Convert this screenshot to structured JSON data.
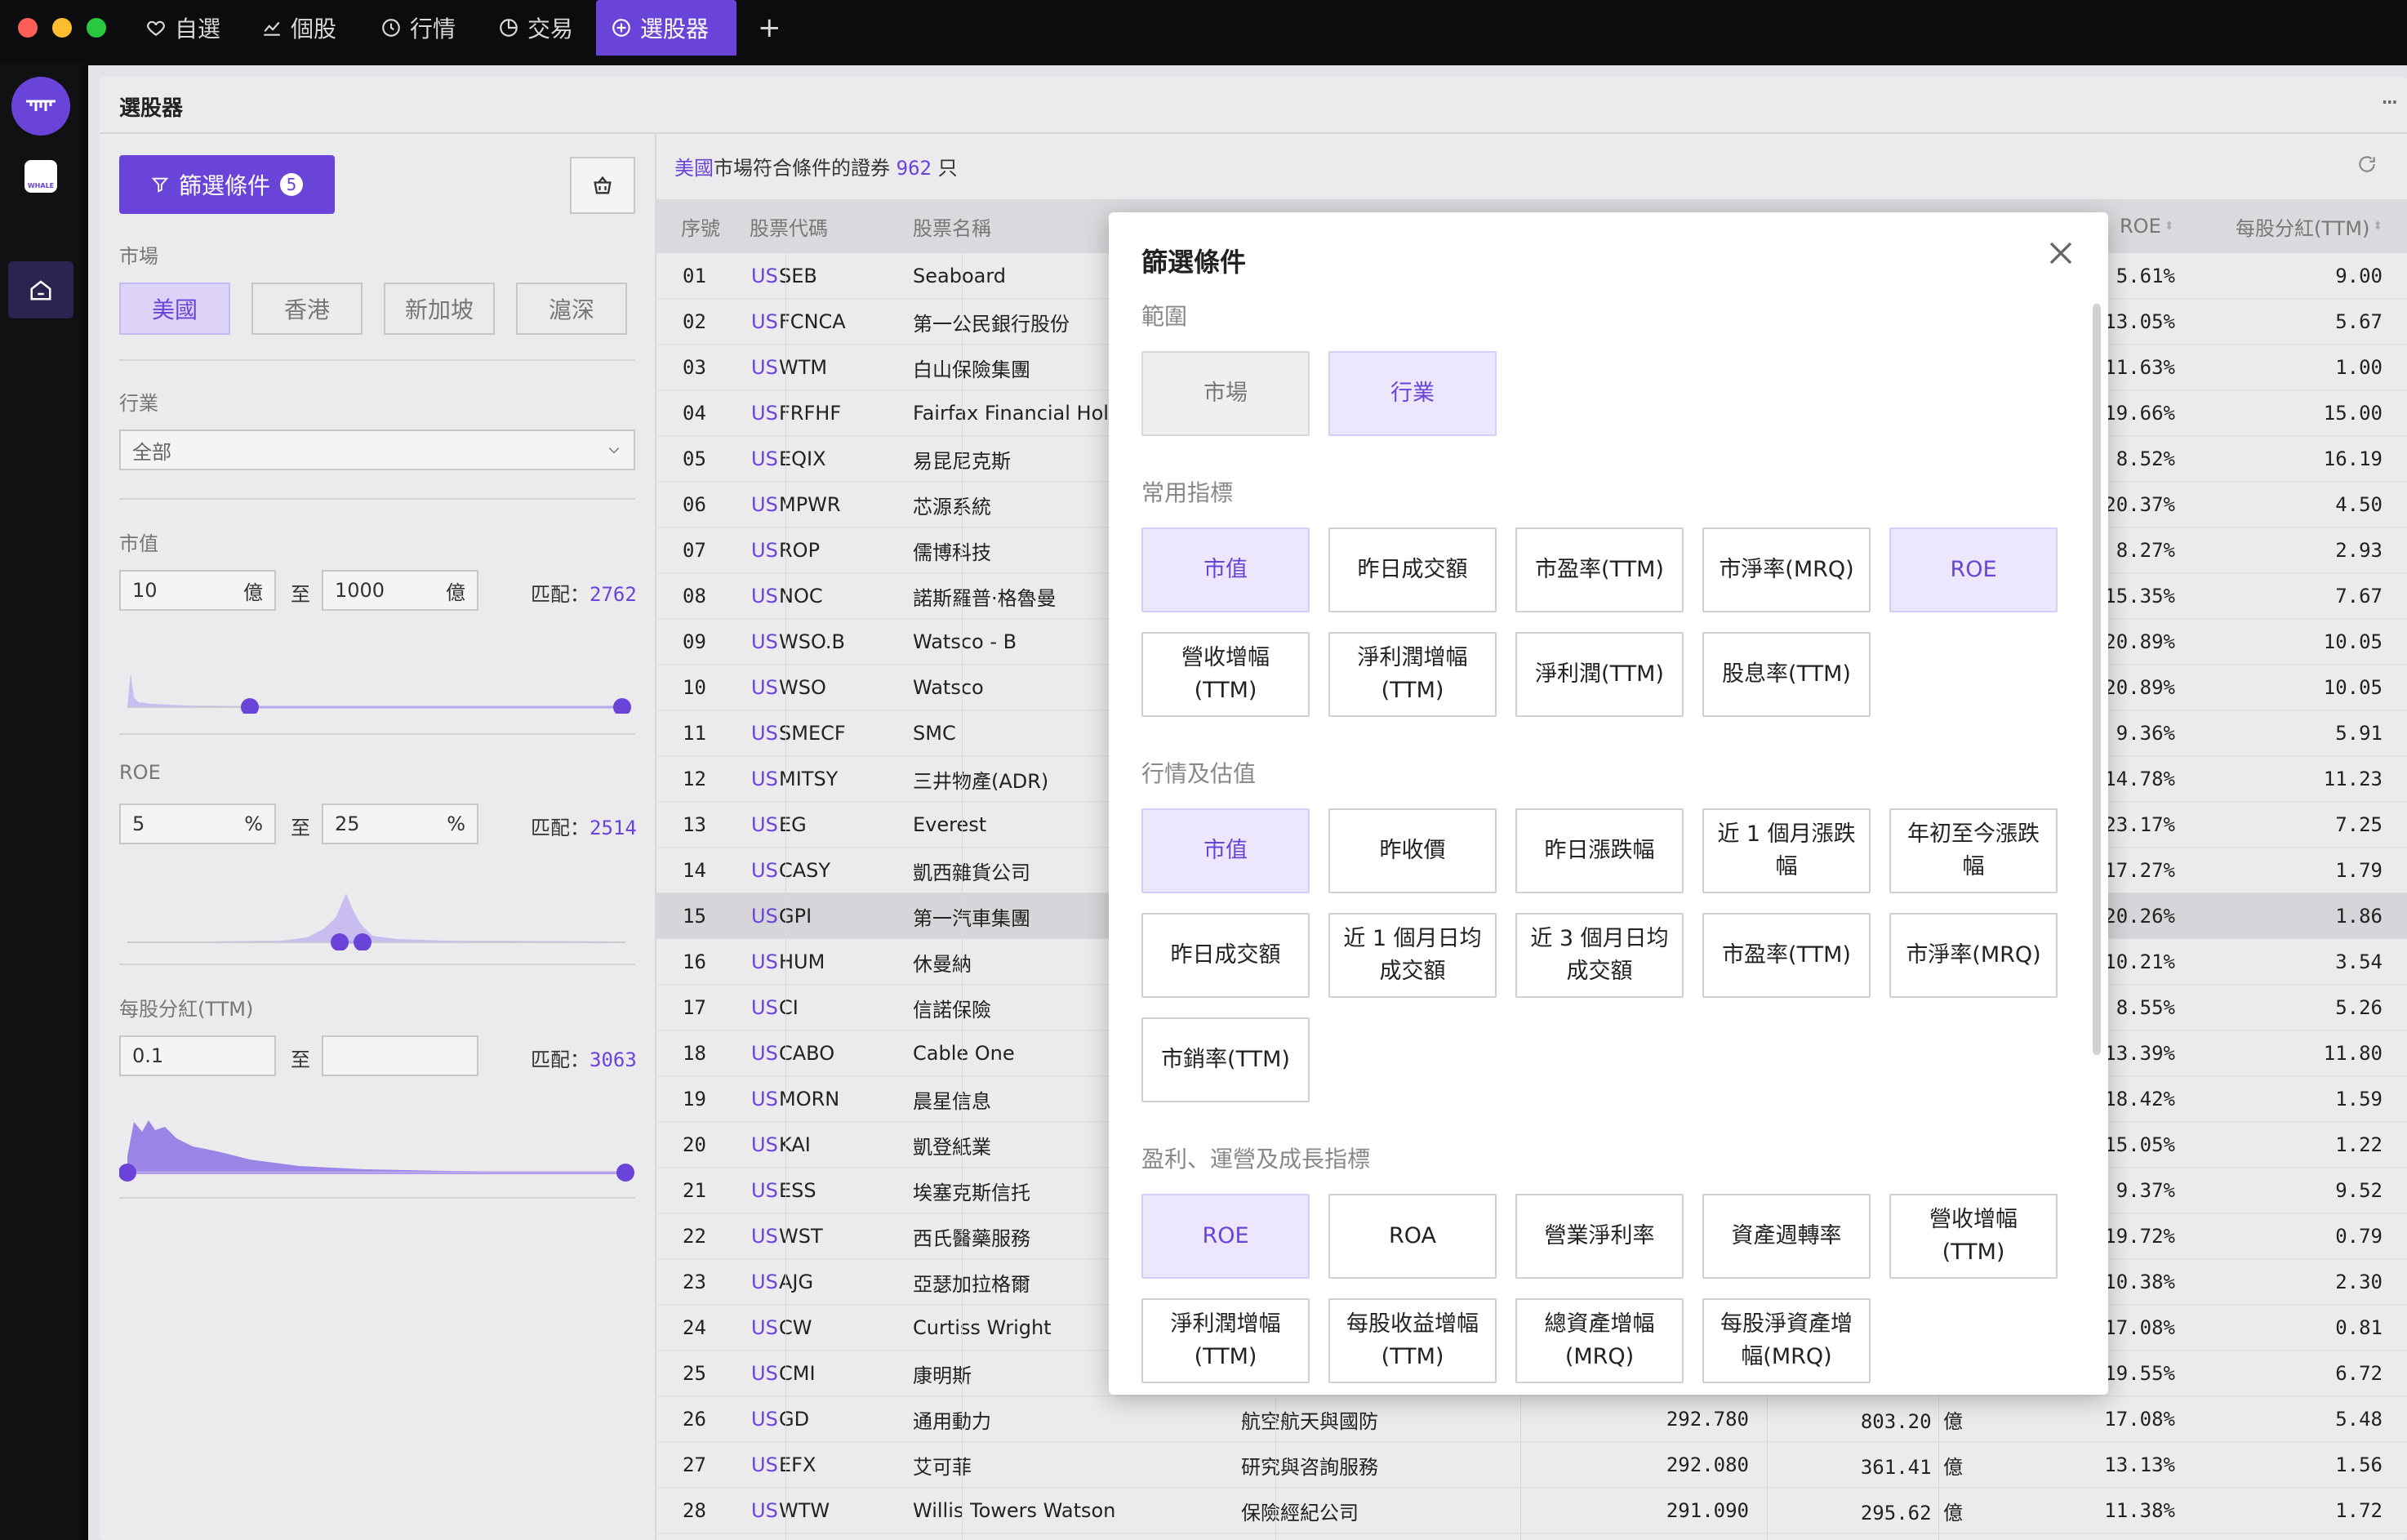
{
  "titlebar": {
    "tabs": [
      {
        "label": "自選",
        "icon": "heart-icon"
      },
      {
        "label": "個股",
        "icon": "chart-line-icon"
      },
      {
        "label": "行情",
        "icon": "clock-icon"
      },
      {
        "label": "交易",
        "icon": "pie-icon"
      },
      {
        "label": "選股器",
        "icon": "screener-icon",
        "active": true
      }
    ],
    "add_tab": "+"
  },
  "sidebar": {
    "logo_text": "WHALE"
  },
  "page": {
    "title": "選股器",
    "more": "···"
  },
  "filter_panel": {
    "filter_button": "篩選條件",
    "filter_count": "5",
    "market_label": "市場",
    "markets": [
      "美國",
      "香港",
      "新加坡",
      "滬深"
    ],
    "selected_market": "美國",
    "industry_label": "行業",
    "industry_value": "全部",
    "market_cap": {
      "label": "市值",
      "min": "10",
      "max": "1000",
      "unit": "億",
      "to": "至",
      "match_label": "匹配：",
      "match": "2762"
    },
    "roe": {
      "label": "ROE",
      "min": "5",
      "max": "25",
      "unit": "%",
      "to": "至",
      "match_label": "匹配：",
      "match": "2514"
    },
    "dividend": {
      "label": "每股分紅(TTM)",
      "min": "0.1",
      "max": "",
      "to": "至",
      "match_label": "匹配：",
      "match": "3063"
    }
  },
  "results": {
    "market_word": "美國",
    "summary_mid": "市場符合條件的證券",
    "count": "962",
    "summary_end": "只",
    "columns": {
      "no": "序號",
      "code": "股票代碼",
      "name": "股票名稱",
      "roe": "ROE",
      "div": "每股分紅(TTM)"
    },
    "rows": [
      {
        "no": "01",
        "mkt": "US",
        "code": "SEB",
        "name": "Seaboard",
        "roe": "5.61%",
        "div": "9.00"
      },
      {
        "no": "02",
        "mkt": "US",
        "code": "FCNCA",
        "name": "第一公民銀行股份",
        "roe": "13.05%",
        "div": "5.67"
      },
      {
        "no": "03",
        "mkt": "US",
        "code": "WTM",
        "name": "白山保險集團",
        "roe": "11.63%",
        "div": "1.00"
      },
      {
        "no": "04",
        "mkt": "US",
        "code": "FRFHF",
        "name": "Fairfax Financial Hold",
        "roe": "19.66%",
        "div": "15.00"
      },
      {
        "no": "05",
        "mkt": "US",
        "code": "EQIX",
        "name": "易昆尼克斯",
        "roe": "8.52%",
        "div": "16.19"
      },
      {
        "no": "06",
        "mkt": "US",
        "code": "MPWR",
        "name": "芯源系統",
        "roe": "20.37%",
        "div": "4.50"
      },
      {
        "no": "07",
        "mkt": "US",
        "code": "ROP",
        "name": "儒博科技",
        "roe": "8.27%",
        "div": "2.93"
      },
      {
        "no": "08",
        "mkt": "US",
        "code": "NOC",
        "name": "諾斯羅普·格魯曼",
        "roe": "15.35%",
        "div": "7.67"
      },
      {
        "no": "09",
        "mkt": "US",
        "code": "WSO.B",
        "name": "Watsco - B",
        "roe": "20.89%",
        "div": "10.05"
      },
      {
        "no": "10",
        "mkt": "US",
        "code": "WSO",
        "name": "Watsco",
        "roe": "20.89%",
        "div": "10.05"
      },
      {
        "no": "11",
        "mkt": "US",
        "code": "SMECF",
        "name": "SMC",
        "roe": "9.36%",
        "div": "5.91"
      },
      {
        "no": "12",
        "mkt": "US",
        "code": "MITSY",
        "name": "三井物產(ADR)",
        "roe": "14.78%",
        "div": "11.23"
      },
      {
        "no": "13",
        "mkt": "US",
        "code": "EG",
        "name": "Everest",
        "roe": "23.17%",
        "div": "7.25"
      },
      {
        "no": "14",
        "mkt": "US",
        "code": "CASY",
        "name": "凱西雜貨公司",
        "roe": "17.27%",
        "div": "1.79"
      },
      {
        "no": "15",
        "mkt": "US",
        "code": "GPI",
        "name": "第一汽車集團",
        "roe": "20.26%",
        "div": "1.86"
      },
      {
        "no": "16",
        "mkt": "US",
        "code": "HUM",
        "name": "休曼納",
        "roe": "10.21%",
        "div": "3.54"
      },
      {
        "no": "17",
        "mkt": "US",
        "code": "CI",
        "name": "信諾保險",
        "roe": "8.55%",
        "div": "5.26"
      },
      {
        "no": "18",
        "mkt": "US",
        "code": "CABO",
        "name": "Cable One",
        "roe": "13.39%",
        "div": "11.80"
      },
      {
        "no": "19",
        "mkt": "US",
        "code": "MORN",
        "name": "晨星信息",
        "roe": "18.42%",
        "div": "1.59"
      },
      {
        "no": "20",
        "mkt": "US",
        "code": "KAI",
        "name": "凱登紙業",
        "roe": "15.05%",
        "div": "1.22"
      },
      {
        "no": "21",
        "mkt": "US",
        "code": "ESS",
        "name": "埃塞克斯信托",
        "roe": "9.37%",
        "div": "9.52"
      },
      {
        "no": "22",
        "mkt": "US",
        "code": "WST",
        "name": "西氏醫藥服務",
        "roe": "19.72%",
        "div": "0.79"
      },
      {
        "no": "23",
        "mkt": "US",
        "code": "AJG",
        "name": "亞瑟加拉格爾",
        "roe": "10.38%",
        "div": "2.30"
      },
      {
        "no": "24",
        "mkt": "US",
        "code": "CW",
        "name": "Curtiss Wright",
        "roe": "17.08%",
        "div": "0.81"
      },
      {
        "no": "25",
        "mkt": "US",
        "code": "CMI",
        "name": "康明斯",
        "roe": "19.55%",
        "div": "6.72"
      },
      {
        "no": "26",
        "mkt": "US",
        "code": "GD",
        "name": "通用動力",
        "industry": "航空航天與國防",
        "c1": "292.780",
        "c2": "803.20 億",
        "roe": "17.08%",
        "div": "5.48"
      },
      {
        "no": "27",
        "mkt": "US",
        "code": "EFX",
        "name": "艾可菲",
        "industry": "研究與咨詢服務",
        "c1": "292.080",
        "c2": "361.41 億",
        "roe": "13.13%",
        "div": "1.56"
      },
      {
        "no": "28",
        "mkt": "US",
        "code": "WTW",
        "name": "Willis Towers Watson",
        "industry": "保險經紀公司",
        "c1": "291.090",
        "c2": "295.62 億",
        "roe": "11.38%",
        "div": "1.72"
      }
    ]
  },
  "modal": {
    "title": "篩選條件",
    "sections": [
      {
        "title": "範圍",
        "options": [
          {
            "label": "市場",
            "state": "gray"
          },
          {
            "label": "行業",
            "state": "sel"
          }
        ]
      },
      {
        "title": "常用指標",
        "options": [
          {
            "label": "市值",
            "state": "sel"
          },
          {
            "label": "昨日成交額"
          },
          {
            "label": "市盈率(TTM)"
          },
          {
            "label": "市淨率(MRQ)"
          },
          {
            "label": "ROE",
            "state": "sel"
          },
          {
            "label": "營收增幅 (TTM)"
          },
          {
            "label": "淨利潤增幅 (TTM)"
          },
          {
            "label": "淨利潤(TTM)"
          },
          {
            "label": "股息率(TTM)"
          }
        ]
      },
      {
        "title": "行情及估值",
        "options": [
          {
            "label": "市值",
            "state": "sel"
          },
          {
            "label": "昨收價"
          },
          {
            "label": "昨日漲跌幅"
          },
          {
            "label": "近 1 個月漲跌幅"
          },
          {
            "label": "年初至今漲跌幅"
          },
          {
            "label": "昨日成交額"
          },
          {
            "label": "近 1 個月日均成交額"
          },
          {
            "label": "近 3 個月日均成交額"
          },
          {
            "label": "市盈率(TTM)"
          },
          {
            "label": "市淨率(MRQ)"
          },
          {
            "label": "市銷率(TTM)"
          }
        ]
      },
      {
        "title": "盈利、運營及成長指標",
        "options": [
          {
            "label": "ROE",
            "state": "sel"
          },
          {
            "label": "ROA"
          },
          {
            "label": "營業淨利率"
          },
          {
            "label": "資產週轉率"
          },
          {
            "label": "營收增幅 (TTM)"
          },
          {
            "label": "淨利潤增幅 (TTM)"
          },
          {
            "label": "每股收益增幅 (TTM)"
          },
          {
            "label": "總資產增幅 (MRQ)"
          },
          {
            "label": "每股淨資產增幅(MRQ)"
          }
        ]
      }
    ]
  },
  "colors": {
    "accent": "#6a43d9",
    "selected_bg": "#ece7fc"
  }
}
